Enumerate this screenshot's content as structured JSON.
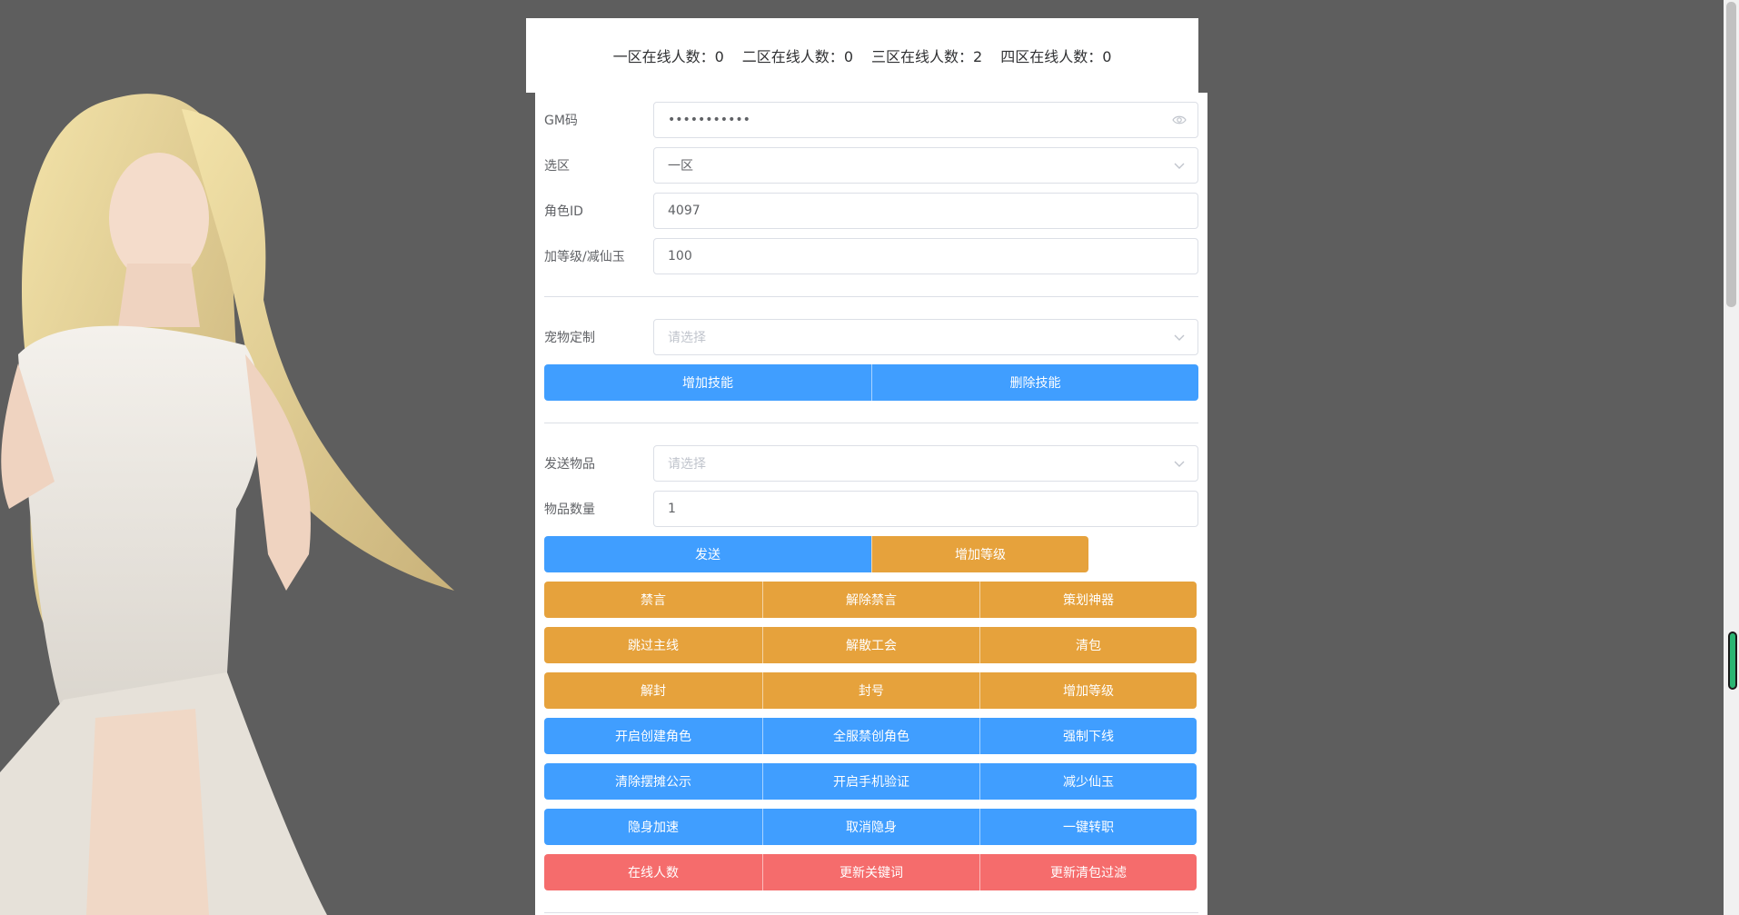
{
  "stats": [
    {
      "label": "一区在线人数：",
      "value": "0"
    },
    {
      "label": "二区在线人数：",
      "value": "0"
    },
    {
      "label": "三区在线人数：",
      "value": "2"
    },
    {
      "label": "四区在线人数：",
      "value": "0"
    }
  ],
  "form": {
    "gm_code": {
      "label": "GM码",
      "value": "•••••••••••"
    },
    "zone": {
      "label": "选区",
      "value": "一区"
    },
    "role_id": {
      "label": "角色ID",
      "value": "4097"
    },
    "level": {
      "label": "加等级/减仙玉",
      "value": "100"
    },
    "pet": {
      "label": "宠物定制",
      "placeholder": "请选择"
    },
    "item": {
      "label": "发送物品",
      "placeholder": "请选择"
    },
    "item_qty": {
      "label": "物品数量",
      "value": "1"
    }
  },
  "buttons": {
    "add_skill": "增加技能",
    "delete_skill": "删除技能",
    "send": "发送",
    "add_level": "增加等级",
    "mute": "禁言",
    "unmute": "解除禁言",
    "plan_artifact": "策划神器",
    "skip_main": "跳过主线",
    "disband_guild": "解散工会",
    "clear_bag": "清包",
    "unban": "解封",
    "ban": "封号",
    "add_level_2": "增加等级",
    "enable_create_role": "开启创建角色",
    "ban_create_all": "全服禁创角色",
    "force_offline": "强制下线",
    "clear_stall_notice": "清除摆摊公示",
    "enable_phone_verify": "开启手机验证",
    "reduce_jade": "减少仙玉",
    "stealth_speed": "隐身加速",
    "cancel_stealth": "取消隐身",
    "one_key_transfer": "一键转职",
    "online_count": "在线人数",
    "update_keywords": "更新关键词",
    "update_bag_filter": "更新清包过滤"
  },
  "colors": {
    "primary": "#409eff",
    "warning": "#e6a23c",
    "danger": "#f56c6c",
    "background": "#5e5e5e"
  }
}
